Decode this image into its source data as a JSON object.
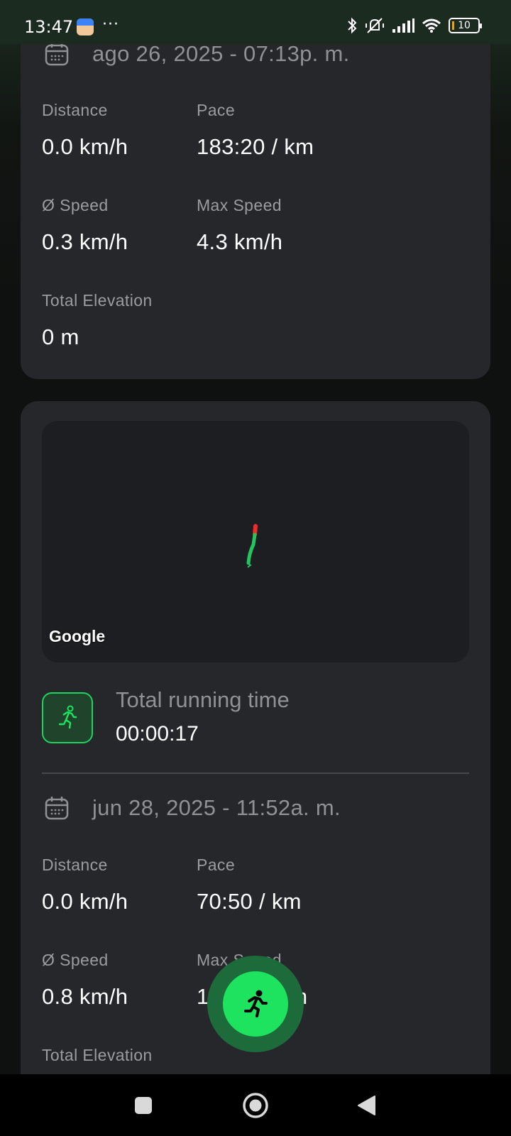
{
  "status_bar": {
    "time": "13:47",
    "dots": "···",
    "battery": "10"
  },
  "cards": [
    {
      "date": "ago 26, 2025 - 07:13p. m.",
      "stats": {
        "distance_label": "Distance",
        "distance_value": "0.0 km/h",
        "pace_label": "Pace",
        "pace_value": "183:20 / km",
        "avg_speed_label": "Ø Speed",
        "avg_speed_value": "0.3 km/h",
        "max_speed_label": "Max Speed",
        "max_speed_value": "4.3 km/h",
        "elevation_label": "Total Elevation",
        "elevation_value": "0 m"
      }
    },
    {
      "map_attribution": "Google",
      "runtime_label": "Total running time",
      "runtime_value": "00:00:17",
      "date": "jun 28, 2025 - 11:52a. m.",
      "stats": {
        "distance_label": "Distance",
        "distance_value": "0.0 km/h",
        "pace_label": "Pace",
        "pace_value": "70:50 / km",
        "avg_speed_label": "Ø Speed",
        "avg_speed_value": "0.8 km/h",
        "max_speed_label": "Max Speed",
        "max_speed_value": "13.",
        "max_speed_value_tail": "/h",
        "elevation_label": "Total Elevation"
      }
    }
  ],
  "colors": {
    "accent_green": "#1ee35f",
    "route_green": "#22c55e",
    "route_red": "#ef2b2b",
    "card_bg": "#25272a"
  },
  "icons": {
    "calendar": "calendar-icon",
    "runner": "runner-icon",
    "nav_recents": "square-icon",
    "nav_home": "circle-icon",
    "nav_back": "triangle-back-icon"
  }
}
